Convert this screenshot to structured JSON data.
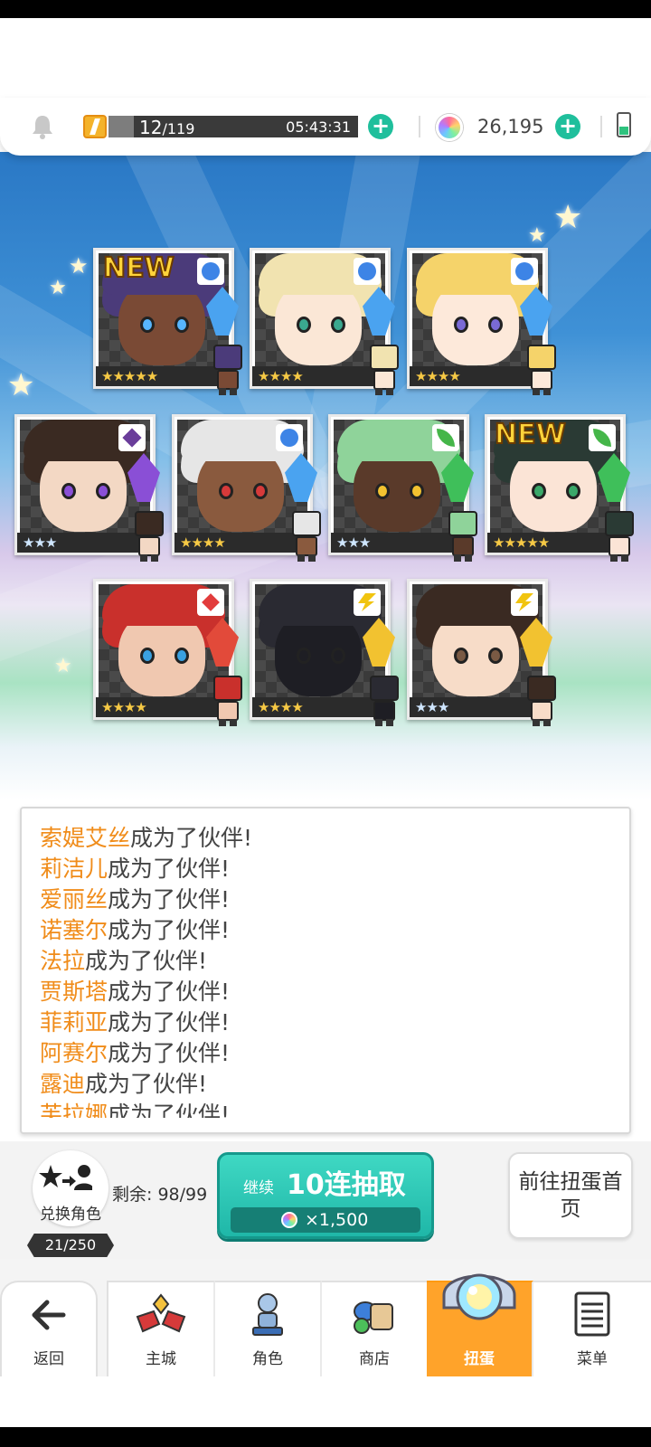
{
  "status": {
    "energy_current": "12",
    "energy_max": "/119",
    "energy_fraction": 0.101,
    "energy_timer": "05:43:31",
    "gems": "26,195"
  },
  "cards": [
    {
      "new": "NEW",
      "stars": "★★★★★",
      "element": "water"
    },
    {
      "new": "",
      "stars": "★★★★",
      "element": "water"
    },
    {
      "new": "",
      "stars": "★★★★",
      "element": "water"
    },
    {
      "new": "",
      "stars": "★★★",
      "element": "dark"
    },
    {
      "new": "",
      "stars": "★★★★",
      "element": "water"
    },
    {
      "new": "",
      "stars": "★★★",
      "element": "wind"
    },
    {
      "new": "NEW",
      "stars": "★★★★★",
      "element": "wind"
    },
    {
      "new": "",
      "stars": "★★★★",
      "element": "fire"
    },
    {
      "new": "",
      "stars": "★★★★",
      "element": "light"
    },
    {
      "new": "",
      "stars": "★★★",
      "element": "light"
    }
  ],
  "log": {
    "suffix": "成为了伙伴!",
    "entries": [
      "索媞艾丝",
      "莉洁儿",
      "爱丽丝",
      "诺塞尔",
      "法拉",
      "贾斯塔",
      "菲莉亚",
      "阿赛尔",
      "露迪",
      "芙拉娜"
    ]
  },
  "actions": {
    "exchange_label": "兑换角色",
    "exchange_count": "21/250",
    "remaining": "剩余: 98/99",
    "pull_continue": "继续",
    "pull_label": "10连抽取",
    "pull_cost": "×1,500",
    "goto_label": "前往扭蛋首页"
  },
  "nav": {
    "back": "返回",
    "items": [
      "主城",
      "角色",
      "商店",
      "扭蛋",
      "菜单"
    ],
    "active": "扭蛋"
  },
  "colors": {
    "accent": "#1fbf9c",
    "log_name": "#f08c1a",
    "nav_active": "#ffa32a"
  }
}
